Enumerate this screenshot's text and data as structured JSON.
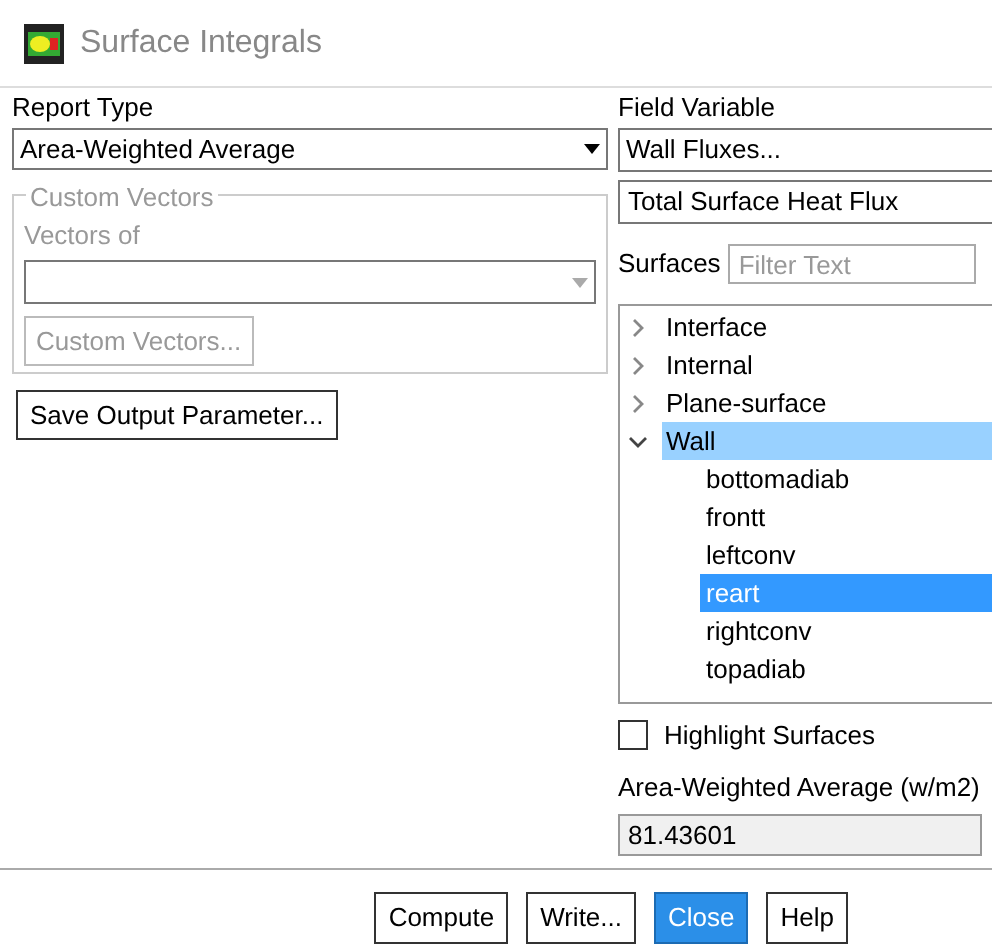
{
  "window": {
    "title": "Surface Integrals"
  },
  "report_type": {
    "label": "Report Type",
    "value": "Area-Weighted Average"
  },
  "custom_vectors": {
    "title": "Custom Vectors",
    "disabled": true,
    "vectors_label": "Vectors of",
    "button": "Custom Vectors..."
  },
  "save_button": "Save Output Parameter...",
  "field_variable": {
    "label": "Field Variable",
    "category": "Wall Fluxes...",
    "value": "Total Surface Heat Flux"
  },
  "surfaces": {
    "label": "Surfaces",
    "placeholder": "Filter Text",
    "tree": [
      {
        "label": "Interface",
        "expanded": false,
        "selected": false,
        "hovered": false
      },
      {
        "label": "Internal",
        "expanded": false,
        "selected": false,
        "hovered": false
      },
      {
        "label": "Plane-surface",
        "expanded": false,
        "selected": false,
        "hovered": false
      },
      {
        "label": "Wall",
        "expanded": true,
        "selected": false,
        "hovered": true,
        "children": [
          {
            "label": "bottomadiab",
            "selected": false
          },
          {
            "label": "frontt",
            "selected": false
          },
          {
            "label": "leftconv",
            "selected": false
          },
          {
            "label": "reart",
            "selected": true
          },
          {
            "label": "rightconv",
            "selected": false
          },
          {
            "label": "topadiab",
            "selected": false
          }
        ]
      }
    ]
  },
  "highlight_surfaces": {
    "label": "Highlight Surfaces",
    "checked": false
  },
  "result": {
    "label": "Area-Weighted Average (w/m2)",
    "value": "81.43601"
  },
  "buttons": [
    {
      "label": "Compute",
      "default": false
    },
    {
      "label": "Write...",
      "default": false
    },
    {
      "label": "Close",
      "default": true
    },
    {
      "label": "Help",
      "default": false
    }
  ]
}
